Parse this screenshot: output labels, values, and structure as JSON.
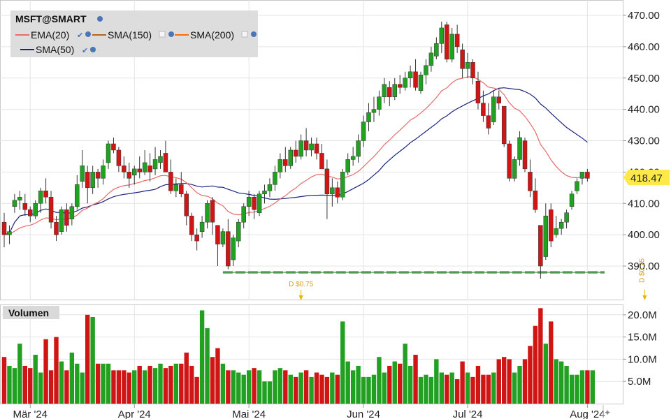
{
  "chart_data": [
    {
      "type": "candlestick",
      "symbol": "MSFT@SMART",
      "ylim": [
        385,
        472
      ],
      "yticks": [
        "470.00",
        "460.00",
        "450.00",
        "440.00",
        "430.00",
        "420.00",
        "410.00",
        "400.00",
        "390.00"
      ],
      "last_price": "418.47",
      "legend": [
        {
          "name": "EMA(20)",
          "color": "#e86a6a"
        },
        {
          "name": "SMA(150)",
          "color": "#b5651d"
        },
        {
          "name": "SMA(200)",
          "color": "#ff6a00"
        },
        {
          "name": "SMA(50)",
          "color": "#1a237e"
        }
      ],
      "x_labels": [
        {
          "label": "Mär '24",
          "index": 5
        },
        {
          "label": "Apr '24",
          "index": 25
        },
        {
          "label": "Mai '24",
          "index": 47
        },
        {
          "label": "Jun '24",
          "index": 69
        },
        {
          "label": "Jul '24",
          "index": 89
        },
        {
          "label": "Aug '24",
          "index": 112
        }
      ],
      "dividends": [
        {
          "label": "D $0.75",
          "index": 57
        },
        {
          "label": "D $0.75",
          "index": 123
        }
      ],
      "support_line": 388,
      "candles": [
        [
          404,
          407,
          396,
          400
        ],
        [
          400,
          403,
          397,
          401
        ],
        [
          409,
          413,
          407,
          411
        ],
        [
          411,
          414,
          408,
          412
        ],
        [
          410,
          413,
          406,
          408
        ],
        [
          408,
          409,
          404,
          406
        ],
        [
          406,
          411,
          405,
          410
        ],
        [
          410,
          415,
          407,
          414
        ],
        [
          414,
          418,
          410,
          412
        ],
        [
          412,
          414,
          402,
          404
        ],
        [
          404,
          406,
          398,
          400
        ],
        [
          401,
          409,
          400,
          408
        ],
        [
          408,
          410,
          401,
          403
        ],
        [
          405,
          410,
          403,
          409
        ],
        [
          409,
          419,
          408,
          416
        ],
        [
          417,
          427,
          415,
          422
        ],
        [
          420,
          422,
          410,
          415
        ],
        [
          415,
          422,
          413,
          420
        ],
        [
          420,
          421,
          415,
          418
        ],
        [
          418,
          424,
          416,
          422
        ],
        [
          423,
          430,
          421,
          429
        ],
        [
          429,
          431,
          426,
          427
        ],
        [
          427,
          428,
          420,
          422
        ],
        [
          422,
          425,
          418,
          420
        ],
        [
          420,
          423,
          415,
          418
        ],
        [
          419,
          422,
          416,
          421
        ],
        [
          421,
          425,
          418,
          420
        ],
        [
          420,
          427,
          419,
          423
        ],
        [
          422,
          426,
          417,
          420
        ],
        [
          421,
          428,
          419,
          424
        ],
        [
          423,
          427,
          421,
          425
        ],
        [
          426,
          430,
          421,
          420
        ],
        [
          420,
          424,
          413,
          414
        ],
        [
          414,
          418,
          412,
          416
        ],
        [
          416,
          420,
          412,
          413
        ],
        [
          413,
          414,
          403,
          406
        ],
        [
          406,
          407,
          398,
          400
        ],
        [
          400,
          402,
          395,
          398
        ],
        [
          401,
          406,
          399,
          404
        ],
        [
          404,
          411,
          402,
          410
        ],
        [
          411,
          412,
          400,
          404
        ],
        [
          403,
          403,
          390,
          397
        ],
        [
          397,
          402,
          396,
          401
        ],
        [
          401,
          405,
          389,
          390
        ],
        [
          392,
          400,
          390,
          399
        ],
        [
          398,
          405,
          396,
          404
        ],
        [
          404,
          410,
          402,
          409
        ],
        [
          409,
          414,
          406,
          412
        ],
        [
          412,
          413,
          405,
          408
        ],
        [
          407,
          414,
          406,
          413
        ],
        [
          413,
          416,
          410,
          414
        ],
        [
          414,
          418,
          412,
          416
        ],
        [
          416,
          422,
          414,
          420
        ],
        [
          420,
          426,
          418,
          424
        ],
        [
          424,
          428,
          420,
          422
        ],
        [
          422,
          428,
          421,
          427
        ],
        [
          427,
          430,
          423,
          425
        ],
        [
          425,
          432,
          424,
          430
        ],
        [
          430,
          434,
          425,
          427
        ],
        [
          427,
          431,
          425,
          429
        ],
        [
          429,
          431,
          424,
          426
        ],
        [
          426,
          429,
          423,
          421
        ],
        [
          421,
          424,
          405,
          413
        ],
        [
          413,
          418,
          409,
          415
        ],
        [
          415,
          417,
          410,
          412
        ],
        [
          412,
          421,
          411,
          420
        ],
        [
          420,
          426,
          419,
          424
        ],
        [
          424,
          428,
          422,
          425
        ],
        [
          425,
          432,
          423,
          430
        ],
        [
          430,
          438,
          428,
          436
        ],
        [
          436,
          442,
          433,
          439
        ],
        [
          439,
          444,
          436,
          440
        ],
        [
          440,
          446,
          438,
          444
        ],
        [
          444,
          450,
          442,
          448
        ],
        [
          447,
          449,
          441,
          444
        ],
        [
          444,
          450,
          443,
          448
        ],
        [
          448,
          451,
          445,
          447
        ],
        [
          447,
          452,
          446,
          450
        ],
        [
          450,
          454,
          447,
          452
        ],
        [
          452,
          456,
          446,
          447
        ],
        [
          446,
          452,
          445,
          451
        ],
        [
          451,
          456,
          448,
          454
        ],
        [
          454,
          460,
          452,
          458
        ],
        [
          457,
          463,
          456,
          461
        ],
        [
          461,
          468,
          458,
          466
        ],
        [
          467,
          468,
          455,
          456
        ],
        [
          456,
          466,
          455,
          464
        ],
        [
          464,
          467,
          458,
          460
        ],
        [
          459,
          461,
          450,
          453
        ],
        [
          453,
          458,
          450,
          455
        ],
        [
          455,
          456,
          448,
          450
        ],
        [
          449,
          452,
          440,
          442
        ],
        [
          442,
          446,
          436,
          438
        ],
        [
          438,
          442,
          432,
          434
        ],
        [
          436,
          446,
          435,
          444
        ],
        [
          444,
          446,
          440,
          442
        ],
        [
          441,
          441,
          428,
          429
        ],
        [
          429,
          430,
          417,
          418
        ],
        [
          418,
          425,
          417,
          424
        ],
        [
          424,
          433,
          422,
          431
        ],
        [
          430,
          431,
          420,
          421
        ],
        [
          420,
          424,
          412,
          414
        ],
        [
          414,
          418,
          407,
          408
        ],
        [
          403,
          403,
          386,
          390
        ],
        [
          393,
          410,
          392,
          406
        ],
        [
          408,
          410,
          396,
          398
        ],
        [
          400,
          406,
          399,
          402
        ],
        [
          402,
          405,
          400,
          404
        ],
        [
          404,
          408,
          402,
          407
        ],
        [
          409,
          414,
          408,
          413
        ],
        [
          414,
          418,
          413,
          417
        ],
        [
          418,
          420,
          416,
          420
        ],
        [
          420,
          421,
          417,
          418
        ]
      ],
      "volume": {
        "ylim": [
          0,
          22
        ],
        "yticks": [
          "20.0M",
          "15.0M",
          "10.0M",
          "5.0M"
        ],
        "label": "Volumen",
        "values": [
          10.5,
          8.5,
          8.0,
          13.5,
          8.5,
          8.0,
          11.0,
          7.0,
          14.5,
          7.5,
          15.0,
          9.5,
          7.5,
          11.5,
          9.0,
          7.0,
          20.0,
          19.5,
          9.0,
          9.0,
          9.0,
          7.5,
          7.5,
          7.5,
          7.0,
          7.5,
          8.5,
          7.5,
          8.5,
          8.0,
          9.0,
          8.0,
          8.5,
          9.0,
          9.0,
          11.5,
          8.5,
          6.0,
          21.0,
          17.0,
          10.5,
          12.5,
          9.0,
          7.5,
          7.5,
          7.0,
          6.5,
          7.5,
          8.0,
          7.5,
          5.0,
          5.0,
          7.5,
          8.0,
          7.5,
          6.5,
          6.0,
          7.0,
          7.5,
          6.0,
          7.0,
          6.5,
          6.0,
          7.0,
          6.5,
          18.5,
          9.5,
          7.5,
          8.5,
          6.0,
          6.0,
          6.5,
          10.5,
          7.0,
          8.5,
          9.5,
          9.0,
          13.5,
          8.5,
          11.0,
          6.0,
          6.5,
          6.0,
          10.0,
          7.0,
          6.5,
          7.0,
          5.5,
          9.5,
          7.0,
          6.0,
          8.5,
          6.5,
          6.5,
          7.0,
          10.0,
          10.5,
          10.0,
          7.0,
          8.5,
          10.0,
          13.0,
          17.5,
          21.5,
          13.5,
          18.5,
          10.0,
          9.5,
          8.5,
          6.5,
          6.5,
          7.5,
          7.5,
          7.5
        ]
      }
    }
  ]
}
